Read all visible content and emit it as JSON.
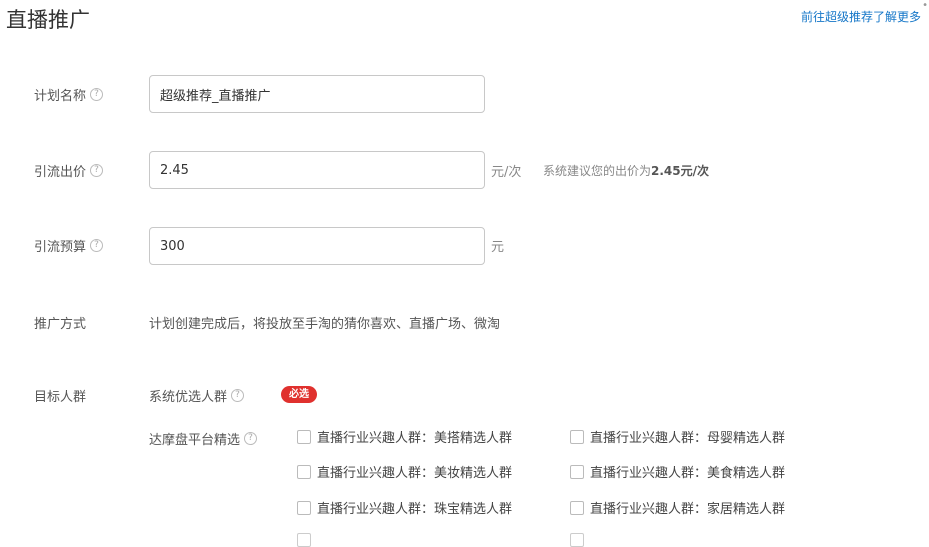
{
  "header": {
    "title": "直播推广",
    "link": "前往超级推荐了解更多"
  },
  "form": {
    "plan_name": {
      "label": "计划名称",
      "value": "超级推荐_直播推广"
    },
    "bid": {
      "label": "引流出价",
      "value": "2.45",
      "unit": "元/次",
      "suggest_prefix": "系统建议您的出价为",
      "suggest_value": "2.45元/次"
    },
    "budget": {
      "label": "引流预算",
      "value": "300",
      "unit": "元"
    },
    "method": {
      "label": "推广方式",
      "text": "计划创建完成后，将投放至手淘的猜你喜欢、直播广场、微淘"
    },
    "target": {
      "label": "目标人群",
      "system_label": "系统优选人群",
      "required_badge": "必选",
      "platform_label": "达摩盘平台精选",
      "options": [
        "直播行业兴趣人群：美搭精选人群",
        "直播行业兴趣人群：母婴精选人群",
        "直播行业兴趣人群：美妆精选人群",
        "直播行业兴趣人群：美食精选人群",
        "直播行业兴趣人群：珠宝精选人群",
        "直播行业兴趣人群：家居精选人群"
      ]
    }
  },
  "icons": {
    "help": "question-circle-icon",
    "checkbox": "checkbox-icon"
  },
  "colors": {
    "link": "#1677c8",
    "badge": "#e0312e"
  }
}
